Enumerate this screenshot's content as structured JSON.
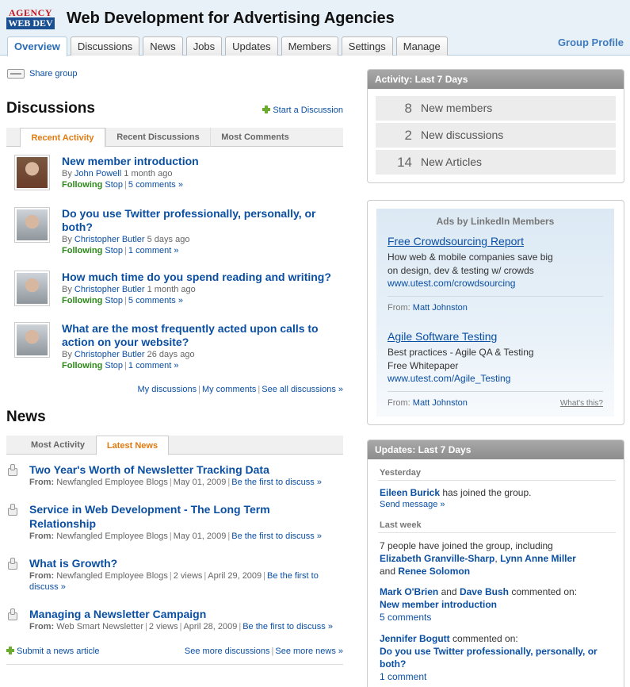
{
  "header": {
    "logo_top": "AGENCY",
    "logo_bottom": "WEB DEV",
    "title": "Web Development for Advertising Agencies",
    "group_profile": "Group Profile",
    "tabs": [
      "Overview",
      "Discussions",
      "News",
      "Jobs",
      "Updates",
      "Members",
      "Settings",
      "Manage"
    ]
  },
  "share": "Share group",
  "discussions": {
    "heading": "Discussions",
    "start": "Start a Discussion",
    "tabs": [
      "Recent Activity",
      "Recent Discussions",
      "Most Comments"
    ],
    "items": [
      {
        "title": "New member introduction",
        "by": "By",
        "author": "John Powell",
        "time": "1 month ago",
        "following": "Following",
        "stop": "Stop",
        "comments": "5 comments »"
      },
      {
        "title": "Do you use Twitter professionally, personally, or both?",
        "by": "By",
        "author": "Christopher Butler",
        "time": "5 days ago",
        "following": "Following",
        "stop": "Stop",
        "comments": "1 comment »"
      },
      {
        "title": "How much time do you spend reading and writing?",
        "by": "By",
        "author": "Christopher Butler",
        "time": "1 month ago",
        "following": "Following",
        "stop": "Stop",
        "comments": "5 comments »"
      },
      {
        "title": "What are the most frequently acted upon calls to action on your website?",
        "by": "By",
        "author": "Christopher Butler",
        "time": "26 days ago",
        "following": "Following",
        "stop": "Stop",
        "comments": "1 comment »"
      }
    ],
    "footer": {
      "my_discussions": "My discussions",
      "my_comments": "My comments",
      "see_all": "See all discussions »"
    }
  },
  "news": {
    "heading": "News",
    "tabs": [
      "Most Activity",
      "Latest News"
    ],
    "items": [
      {
        "title": "Two Year's Worth of Newsletter Tracking Data",
        "from_label": "From:",
        "source": "Newfangled Employee Blogs",
        "views": "",
        "date": "May 01, 2009",
        "discuss": "Be the first to discuss »"
      },
      {
        "title": "Service in Web Development - The Long Term Relationship",
        "from_label": "From:",
        "source": "Newfangled Employee Blogs",
        "views": "",
        "date": "May 01, 2009",
        "discuss": "Be the first to discuss »"
      },
      {
        "title": "What is Growth?",
        "from_label": "From:",
        "source": "Newfangled Employee Blogs",
        "views": "2 views",
        "date": "April 29, 2009",
        "discuss_1": "Be the first to",
        "discuss_2": "discuss »"
      },
      {
        "title": "Managing a Newsletter Campaign",
        "from_label": "From:",
        "source": "Web Smart Newsletter",
        "views": "2 views",
        "date": "April 28, 2009",
        "discuss": "Be the first to discuss »"
      }
    ],
    "submit": "Submit a news article",
    "see_more_discussions": "See more discussions",
    "see_more_news": "See more news »"
  },
  "activity": {
    "heading": "Activity: Last 7 Days",
    "stats": [
      {
        "num": "8",
        "label": "New members"
      },
      {
        "num": "2",
        "label": "New discussions"
      },
      {
        "num": "14",
        "label": "New Articles"
      }
    ]
  },
  "ads": {
    "heading": "Ads by LinkedIn Members",
    "items": [
      {
        "title": "Free Crowdsourcing Report",
        "lines": [
          "How web & mobile companies save big",
          "on design, dev & testing w/ crowds"
        ],
        "url": "www.utest.com/crowdsourcing",
        "from_label": "From:",
        "from": "Matt Johnston"
      },
      {
        "title": "Agile Software Testing",
        "lines": [
          "Best practices - Agile QA & Testing",
          "Free Whitepaper"
        ],
        "url": "www.utest.com/Agile_Testing",
        "from_label": "From:",
        "from": "Matt Johnston"
      }
    ],
    "whats_this": "What's this?"
  },
  "updates": {
    "heading": "Updates: Last 7 Days",
    "yesterday": "Yesterday",
    "y_name": "Eileen Burick",
    "y_text": "has joined the group.",
    "send_message": "Send message »",
    "last_week": "Last week",
    "joined_text": "7 people have joined the group, including",
    "joined_name1": "Elizabeth Granville-Sharp",
    "joined_sep": ",",
    "joined_name2": "Lynn Anne Miller",
    "and": "and",
    "joined_name3": "Renee Solomon",
    "c1_name1": "Mark O'Brien",
    "c1_and": "and",
    "c1_name2": "Dave Bush",
    "c1_text": "commented on:",
    "c1_topic": "New member introduction",
    "c1_link": "5 comments",
    "c2_name": "Jennifer Bogutt",
    "c2_text": "commented on:",
    "c2_topic": "Do you use Twitter professionally, personally, or both?",
    "c2_link": "1 comment"
  }
}
